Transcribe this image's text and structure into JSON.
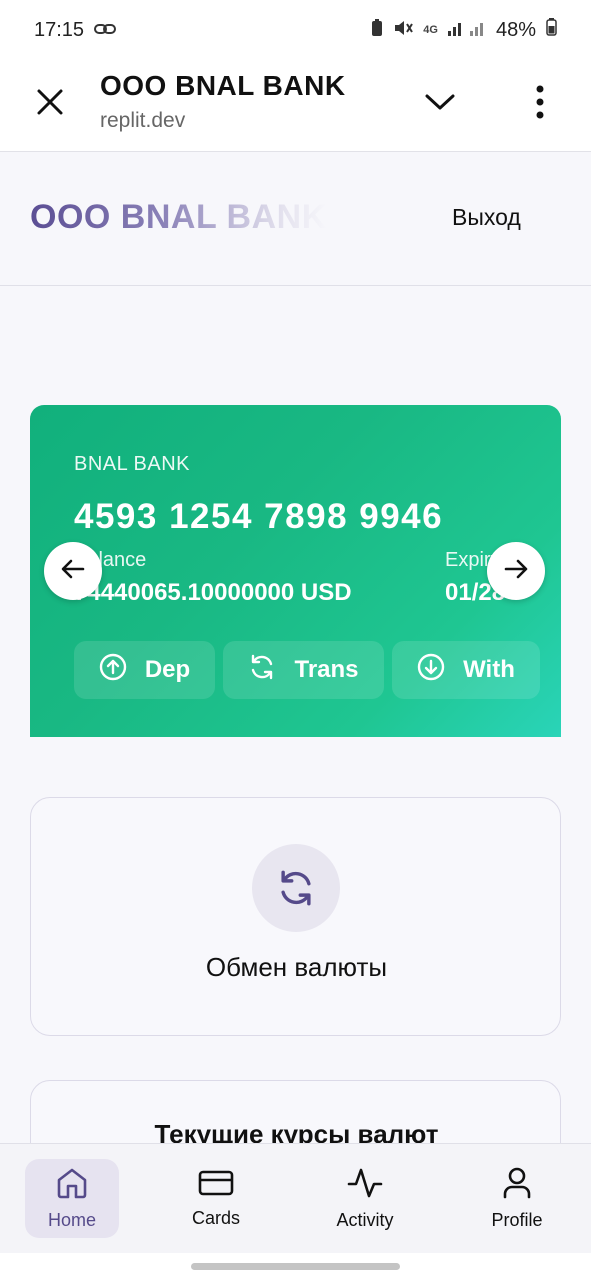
{
  "status_bar": {
    "time": "17:15",
    "network": "4G",
    "battery": "48%",
    "icons": [
      "link-icon",
      "battery-saver-icon",
      "mute-icon",
      "signal-icon",
      "battery-icon"
    ]
  },
  "browser": {
    "title": "OOO BNAL BANK",
    "url": "replit.dev",
    "icons": [
      "close-icon",
      "chevron-down-icon",
      "more-vertical-icon"
    ]
  },
  "app_header": {
    "brand": "OOO BNAL BANK",
    "logout": "Выход"
  },
  "card": {
    "bank": "BNAL BANK",
    "number": "4593 1254 7898 9946",
    "balance_label": "Balance",
    "balance": "74440065.10000000 USD",
    "expiry_label": "Expiry",
    "expiry": "01/28",
    "actions": [
      {
        "label": "Dep",
        "icon": "arrow-up-circle-icon"
      },
      {
        "label": "Trans",
        "icon": "refresh-icon"
      },
      {
        "label": "With",
        "icon": "arrow-down-circle-icon"
      }
    ],
    "colors": {
      "from": "#11b07c",
      "to": "#2ad4b8"
    }
  },
  "exchange": {
    "title": "Обмен валюты",
    "icon": "refresh-icon"
  },
  "rates": {
    "title": "Текущие курсы валют"
  },
  "bottom_nav": {
    "items": [
      {
        "label": "Home",
        "icon": "home-icon",
        "active": true
      },
      {
        "label": "Cards",
        "icon": "credit-card-icon",
        "active": false
      },
      {
        "label": "Activity",
        "icon": "activity-icon",
        "active": false
      },
      {
        "label": "Profile",
        "icon": "user-icon",
        "active": false
      }
    ]
  },
  "colors": {
    "accent": "#554a8a",
    "card_green": "#19b883"
  }
}
